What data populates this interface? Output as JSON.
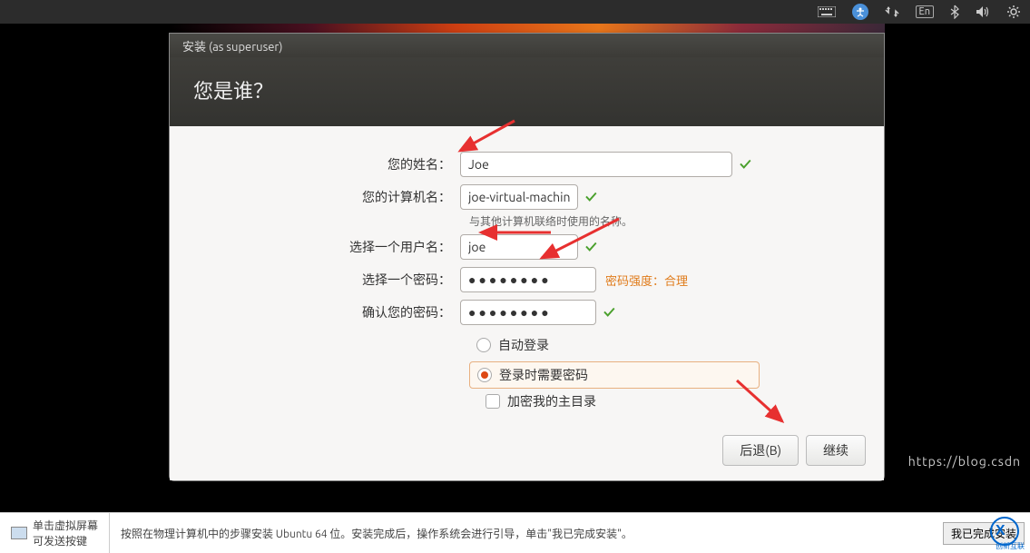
{
  "topbar": {
    "lang": "En"
  },
  "window": {
    "title": "安装 (as superuser)",
    "heading": "您是谁？",
    "name_label": "您的姓名：",
    "name_value": "Joe",
    "host_label": "您的计算机名：",
    "host_value": "joe-virtual-machine",
    "host_hint": "与其他计算机联络时使用的名称。",
    "user_label": "选择一个用户名：",
    "user_value": "joe",
    "pwd_label": "选择一个密码：",
    "pwd_value": "●●●●●●●●",
    "pwd_strength": "密码强度：合理",
    "pwd2_label": "确认您的密码：",
    "pwd2_value": "●●●●●●●●",
    "radio_auto": "自动登录",
    "radio_require": "登录时需要密码",
    "chk_encrypt": "加密我的主目录",
    "back": "后退(B)",
    "continue": "继续"
  },
  "bottom": {
    "hint1": "单击虚拟屏幕",
    "hint2": "可发送按键",
    "msg": "按照在物理计算机中的步骤安装 Ubuntu 64 位。安装完成后，操作系统会进行引导，单击\"我已完成安装\"。",
    "done": "我已完成安装",
    "watermark": "https://blog.csdn",
    "logotxt": "创新互联"
  }
}
